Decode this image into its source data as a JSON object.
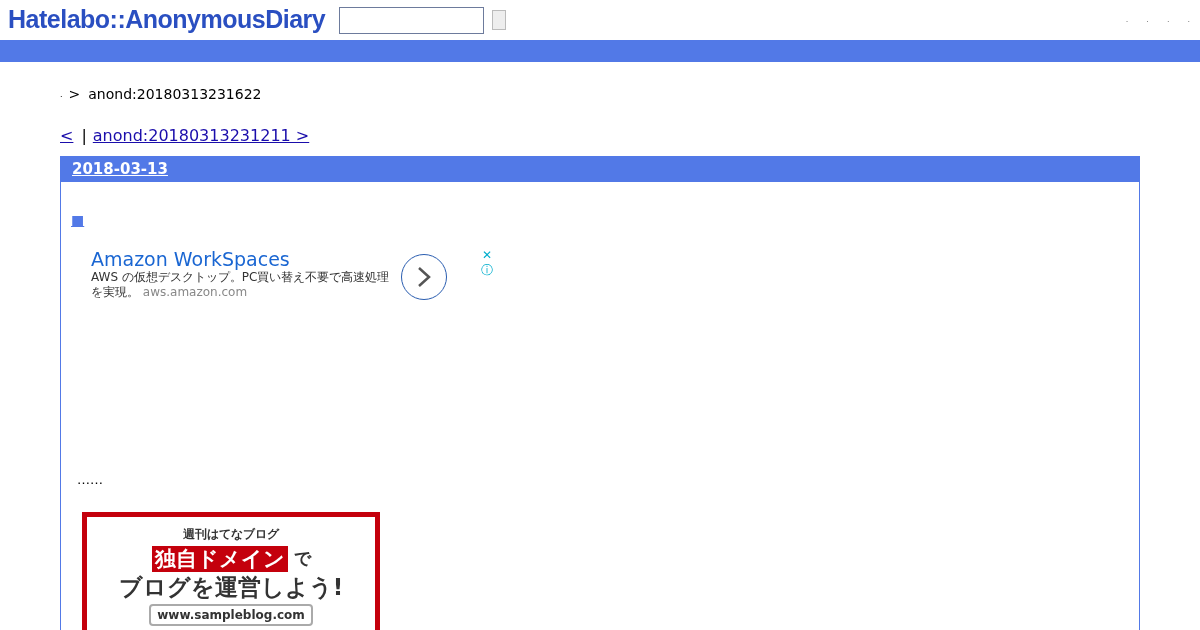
{
  "header": {
    "logo": "Hatelabo::AnonymousDiary",
    "links": [
      ".",
      ".",
      ".",
      "."
    ]
  },
  "breadcrumb": {
    "home": ".",
    "separator": ">",
    "current": "anond:20180313231622"
  },
  "pager": {
    "prev": "<",
    "divider": "|",
    "next": "anond:20180313231211 >"
  },
  "day": {
    "date": "2018-03-13",
    "section_mark": "■",
    "ad": {
      "title": "Amazon WorkSpaces",
      "body": "AWS の仮想デスクトップ。PC買い替え不要で高速処理を実現。",
      "domain": "aws.amazon.com",
      "close": "✕",
      "info": "ⓘ"
    },
    "body": "……",
    "banner": {
      "kicker": "週刊はてなブログ",
      "highlight": "独自ドメイン",
      "highlight_suffix": "で",
      "headline": "ブログを運営しよう!",
      "url": "www.sampleblog.com"
    }
  }
}
